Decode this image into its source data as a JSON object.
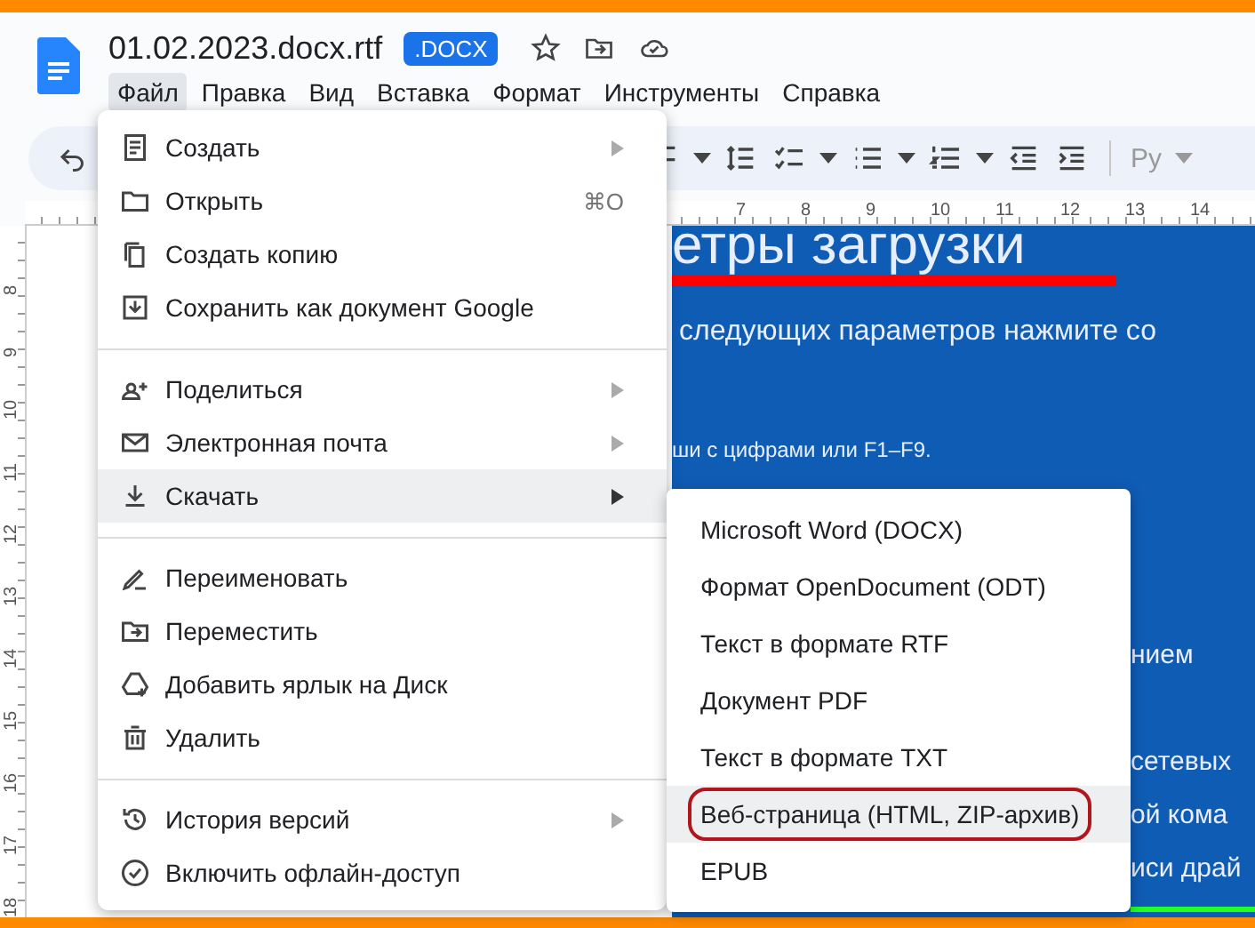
{
  "document": {
    "title": "01.02.2023.docx.rtf",
    "badge": ".DOCX"
  },
  "menubar": [
    {
      "label": "Файл",
      "selected": true
    },
    {
      "label": "Правка",
      "selected": false
    },
    {
      "label": "Вид",
      "selected": false
    },
    {
      "label": "Вставка",
      "selected": false
    },
    {
      "label": "Формат",
      "selected": false
    },
    {
      "label": "Инструменты",
      "selected": false
    },
    {
      "label": "Справка",
      "selected": false
    }
  ],
  "toolbar": {
    "input_tools": "Ру"
  },
  "ruler": {
    "horizontal": [
      "7",
      "8",
      "9",
      "10",
      "11",
      "12",
      "13",
      "14"
    ],
    "vertical": [
      "8",
      "9",
      "10",
      "11",
      "12",
      "13",
      "14",
      "15",
      "16",
      "17",
      "18"
    ]
  },
  "doc_image": {
    "heading": "етры загрузки",
    "line_1": "следующих параметров нажмите со",
    "line_2": "ши с цифрами или F1–F9.",
    "fragments": [
      "нием",
      "сетевых",
      "ой кома",
      "иси драй"
    ]
  },
  "file_menu": {
    "groups": [
      [
        {
          "label": "Создать",
          "submenu": true,
          "selected": false
        },
        {
          "label": "Открыть",
          "shortcut": "⌘O",
          "submenu": false,
          "selected": false
        },
        {
          "label": "Создать копию",
          "submenu": false,
          "selected": false
        },
        {
          "label": "Сохранить как документ Google",
          "submenu": false,
          "selected": false
        }
      ],
      [
        {
          "label": "Поделиться",
          "submenu": true,
          "selected": false
        },
        {
          "label": "Электронная почта",
          "submenu": true,
          "selected": false
        },
        {
          "label": "Скачать",
          "submenu": true,
          "selected": true
        }
      ],
      [
        {
          "label": "Переименовать",
          "submenu": false,
          "selected": false
        },
        {
          "label": "Переместить",
          "submenu": false,
          "selected": false
        },
        {
          "label": "Добавить ярлык на Диск",
          "submenu": false,
          "selected": false
        },
        {
          "label": "Удалить",
          "submenu": false,
          "selected": false
        }
      ],
      [
        {
          "label": "История версий",
          "submenu": true,
          "selected": false
        },
        {
          "label": "Включить офлайн-доступ",
          "submenu": false,
          "selected": false
        }
      ]
    ]
  },
  "download_menu": [
    {
      "label": "Microsoft Word (DOCX)",
      "selected": false,
      "circled": false
    },
    {
      "label": "Формат OpenDocument (ODT)",
      "selected": false,
      "circled": false
    },
    {
      "label": "Текст в формате RTF",
      "selected": false,
      "circled": false
    },
    {
      "label": "Документ PDF",
      "selected": false,
      "circled": false
    },
    {
      "label": "Текст в формате TXT",
      "selected": false,
      "circled": false
    },
    {
      "label": "Веб-страница (HTML, ZIP-архив)",
      "selected": true,
      "circled": true
    },
    {
      "label": "EPUB",
      "selected": false,
      "circled": false
    }
  ]
}
